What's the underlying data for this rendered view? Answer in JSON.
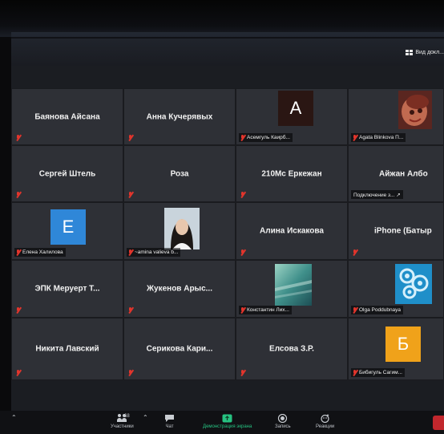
{
  "header": {
    "view_label": "Вид докл..."
  },
  "participants": [
    {
      "display": "Баянова Айсана",
      "label": ""
    },
    {
      "display": "Анна Кучерявых",
      "label": ""
    },
    {
      "display": "A",
      "label": "Асемгуль Каирб..."
    },
    {
      "display": "",
      "label": "Agata Blinkova П..."
    },
    {
      "display": "Сергей Штель",
      "label": ""
    },
    {
      "display": "Роза",
      "label": ""
    },
    {
      "display": "210Мс Еркежан",
      "label": ""
    },
    {
      "display": "Айжан Албо",
      "label": "Подключение з... ↗"
    },
    {
      "display": "E",
      "label": "Елена Халилова"
    },
    {
      "display": "",
      "label": "~amina valieva b..."
    },
    {
      "display": "Алина Искакова",
      "label": ""
    },
    {
      "display": "iPhone (Батыр",
      "label": ""
    },
    {
      "display": "ЭПК Меруерт Т...",
      "label": ""
    },
    {
      "display": "Жукенов Арыс...",
      "label": ""
    },
    {
      "display": "",
      "label": "Константин Лих..."
    },
    {
      "display": "",
      "label": "Olga Poddubnaya"
    },
    {
      "display": "Никита Лавский",
      "label": ""
    },
    {
      "display": "Серикова Кари...",
      "label": ""
    },
    {
      "display": "Елсова З.Р.",
      "label": ""
    },
    {
      "display": "Б",
      "label": "Бибигуль Сагим..."
    }
  ],
  "toolbar": {
    "participants_count": "68",
    "participants_label": "Участники",
    "chat_label": "Чат",
    "share_label": "Демонстрация экрана",
    "record_label": "Запись",
    "reactions_label": "Реакции"
  },
  "colors": {
    "tile_bg": "#2e3036",
    "muted_mic": "#e2352c",
    "avatar_E": "#2f87d8",
    "avatar_B": "#f0a21a",
    "avatar_A": "#2a1613",
    "share_green": "#26c281"
  }
}
